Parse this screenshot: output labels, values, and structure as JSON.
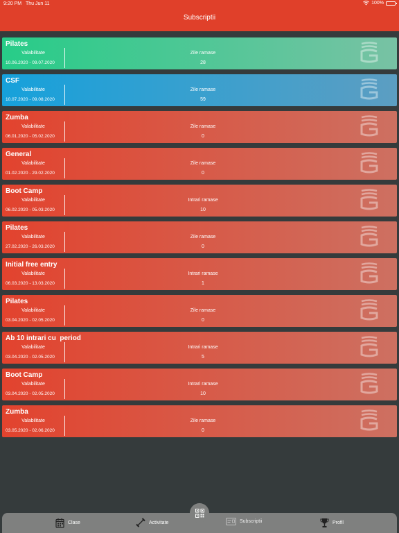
{
  "status_bar": {
    "time": "9:20 PM",
    "date": "Thu Jun 11",
    "battery": "100%"
  },
  "header": {
    "title": "Subscriptii"
  },
  "valid_label": "Valabilitate",
  "subscriptions": [
    {
      "name": "Pilates",
      "range": "10.06.2020 - 09.07.2020",
      "remaining_label": "Zile ramase",
      "remaining": "28",
      "color": "green"
    },
    {
      "name": "CSF",
      "range": "10.07.2020 - 09.08.2020",
      "remaining_label": "Zile ramase",
      "remaining": "59",
      "color": "blue"
    },
    {
      "name": "Zumba",
      "range": "06.01.2020 - 05.02.2020",
      "remaining_label": "Zile ramase",
      "remaining": "0",
      "color": "red"
    },
    {
      "name": "General",
      "range": "01.02.2020 - 29.02.2020",
      "remaining_label": "Zile ramase",
      "remaining": "0",
      "color": "red"
    },
    {
      "name": "Boot Camp",
      "range": "06.02.2020 - 05.03.2020",
      "remaining_label": "Intrari ramase",
      "remaining": "10",
      "color": "red"
    },
    {
      "name": "Pilates",
      "range": "27.02.2020 - 26.03.2020",
      "remaining_label": "Zile ramase",
      "remaining": "0",
      "color": "red"
    },
    {
      "name": "Initial free entry",
      "range": "06.03.2020 - 13.03.2020",
      "remaining_label": "Intrari ramase",
      "remaining": "1",
      "color": "red"
    },
    {
      "name": "Pilates",
      "range": "03.04.2020 - 02.05.2020",
      "remaining_label": "Zile ramase",
      "remaining": "0",
      "color": "red"
    },
    {
      "name": "Ab 10 intrari cu  period",
      "range": "03.04.2020 - 02.05.2020",
      "remaining_label": "Intrari ramase",
      "remaining": "5",
      "color": "red"
    },
    {
      "name": "Boot Camp",
      "range": "03.04.2020 - 02.05.2020",
      "remaining_label": "Intrari ramase",
      "remaining": "10",
      "color": "red"
    },
    {
      "name": "Zumba",
      "range": "03.05.2020 - 02.06.2020",
      "remaining_label": "Zile ramase",
      "remaining": "0",
      "color": "red"
    }
  ],
  "tabs": [
    {
      "label": "Clase",
      "icon": "calendar-icon"
    },
    {
      "label": "Activitate",
      "icon": "dumbbell-icon"
    },
    {
      "label": "Subscriptii",
      "icon": "card-icon",
      "active": true
    },
    {
      "label": "Profil",
      "icon": "trophy-icon"
    }
  ],
  "qr_icon": "qr-code-icon"
}
